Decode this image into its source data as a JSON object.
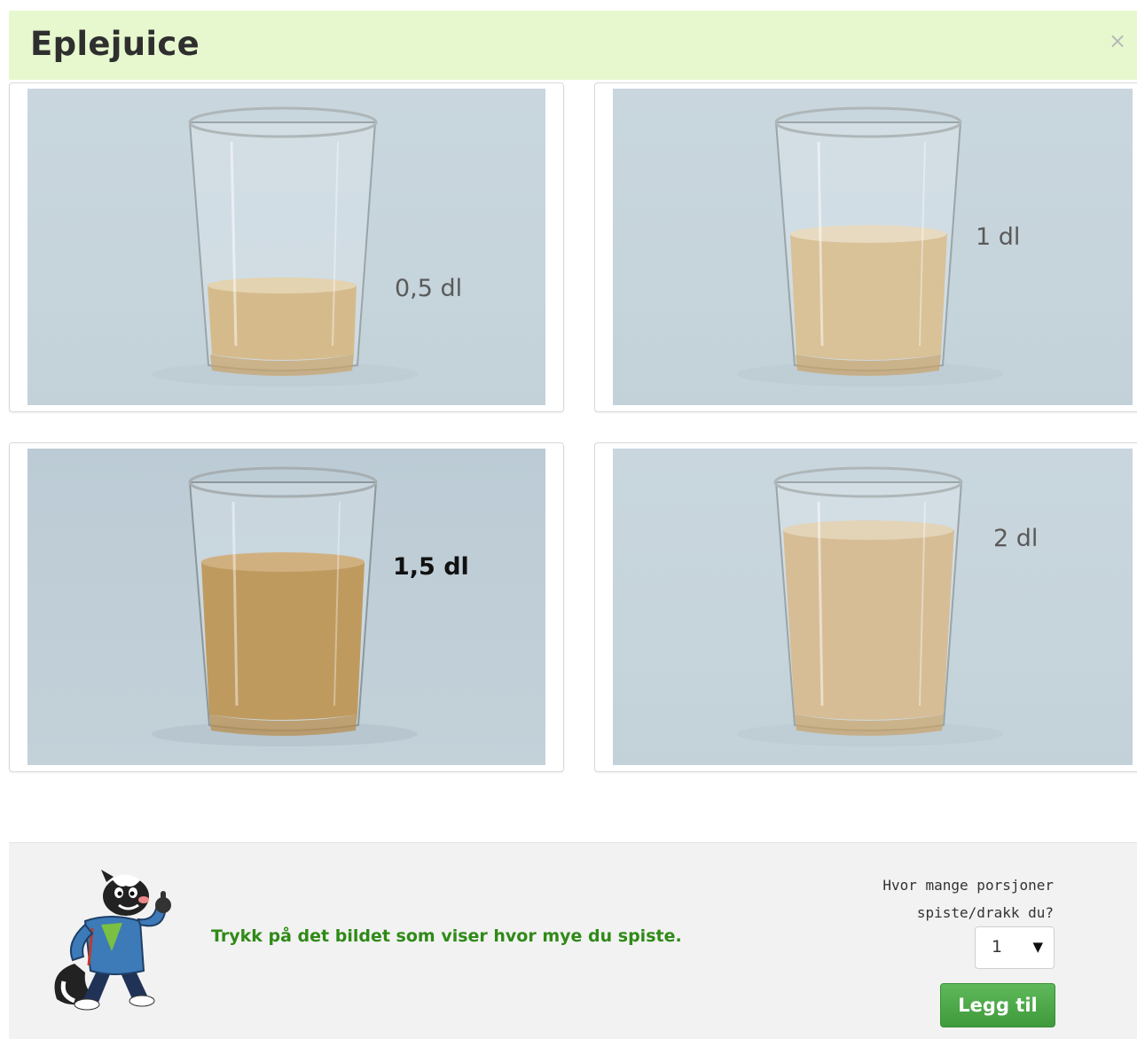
{
  "dialog": {
    "title": "Eplejuice",
    "close_glyph": "×"
  },
  "options": [
    {
      "label": "0,5 dl",
      "fill_fraction": 0.25,
      "selected": false
    },
    {
      "label": "1 dl",
      "fill_fraction": 0.45,
      "selected": false
    },
    {
      "label": "1,5 dl",
      "fill_fraction": 0.6,
      "selected": true
    },
    {
      "label": "2 dl",
      "fill_fraction": 0.8,
      "selected": false
    }
  ],
  "footer": {
    "instruction": "Trykk på det bildet som viser hvor mye du spiste.",
    "question_line1": "Hvor mange porsjoner",
    "question_line2": "spiste/drakk du?",
    "portion_value": "1",
    "portion_arrow": "▼",
    "add_label": "Legg til"
  },
  "colors": {
    "header_bg": "#e7f8cf",
    "instruction": "#2f8a17",
    "button": "#4aa845",
    "juice": "#c8a46c"
  },
  "icons": {
    "mascot": "skunk-mascot-icon",
    "close": "close-icon",
    "dropdown": "chevron-down-icon"
  }
}
